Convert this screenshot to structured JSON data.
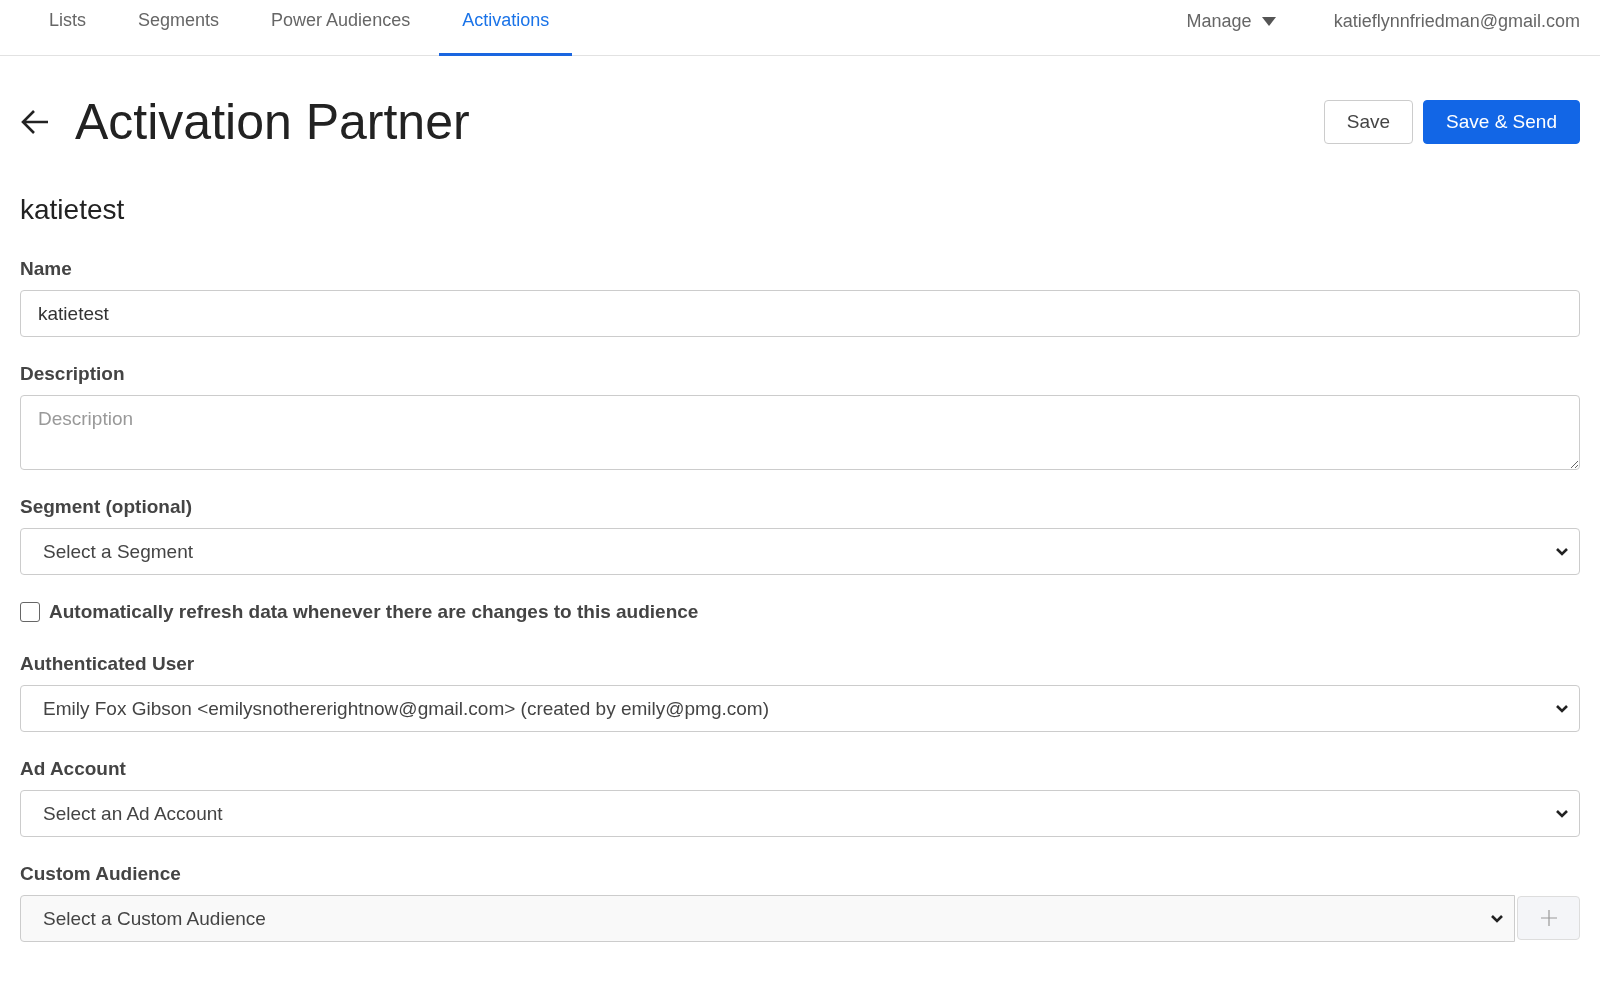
{
  "nav": {
    "tabs": [
      {
        "label": "Lists",
        "selected": false
      },
      {
        "label": "Segments",
        "selected": false
      },
      {
        "label": "Power Audiences",
        "selected": false
      },
      {
        "label": "Activations",
        "selected": true
      }
    ],
    "manage": "Manage",
    "user": "katieflynnfriedman@gmail.com"
  },
  "header": {
    "title": "Activation Partner",
    "buttons": [
      {
        "label": "Save",
        "kind": "secondary"
      },
      {
        "label": "Save & Send",
        "kind": "primary"
      }
    ]
  },
  "subtitle": "katietest",
  "fields": [
    {
      "kind": "text",
      "label": "Name",
      "value": "katietest"
    },
    {
      "kind": "textarea",
      "label": "Description",
      "placeholder": "Description"
    },
    {
      "kind": "select",
      "label": "Segment (optional)",
      "value": "Select a Segment"
    },
    {
      "kind": "checkbox",
      "label": "Automatically refresh data whenever there are changes to this audience",
      "checked": false
    },
    {
      "kind": "select",
      "label": "Authenticated User",
      "value": "Emily Fox Gibson <emilysnothererightnow@gmail.com> (created by emily@pmg.com)"
    },
    {
      "kind": "select",
      "label": "Ad Account",
      "value": "Select an Ad Account"
    },
    {
      "kind": "select-add",
      "label": "Custom Audience",
      "value": "Select a Custom Audience"
    }
  ]
}
